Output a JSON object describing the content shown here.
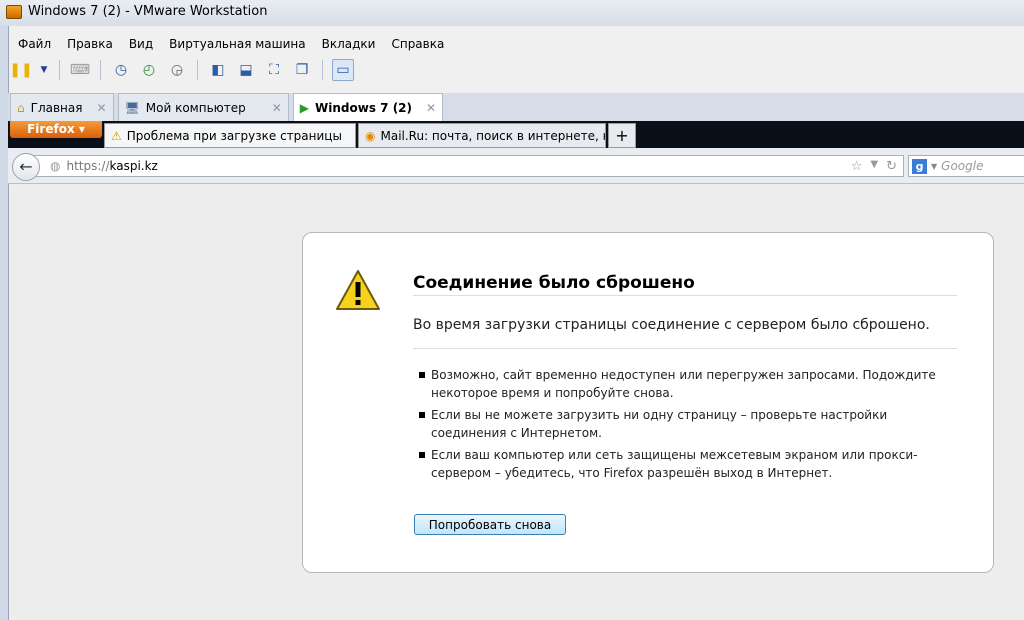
{
  "window": {
    "title": "Windows 7 (2) - VMware Workstation"
  },
  "menu": [
    "Файл",
    "Правка",
    "Вид",
    "Виртуальная машина",
    "Вкладки",
    "Справка"
  ],
  "vm_tabs": [
    {
      "label": "Главная"
    },
    {
      "label": "Мой компьютер"
    },
    {
      "label": "Windows 7 (2)"
    }
  ],
  "firefox": {
    "button": "Firefox",
    "tabs": [
      {
        "label": "Проблема при загрузке страницы"
      },
      {
        "label": "Mail.Ru: почта, поиск в интернете, н..."
      }
    ],
    "url_protocol": "https://",
    "url_host": "kaspi.kz",
    "search_placeholder": "Google"
  },
  "error": {
    "title": "Соединение было сброшено",
    "description": "Во время загрузки страницы соединение с сервером было сброшено.",
    "items": [
      "Возможно, сайт временно недоступен или перегружен запросами. Подождите некоторое время и попробуйте снова.",
      "Если вы не можете загрузить ни одну страницу – проверьте настройки соединения с Интернетом.",
      "Если ваш компьютер или сеть защищены межсетевым экраном или прокси-сервером – убедитесь, что Firefox разрешён выход в Интернет."
    ],
    "retry_button": "Попробовать снова"
  }
}
